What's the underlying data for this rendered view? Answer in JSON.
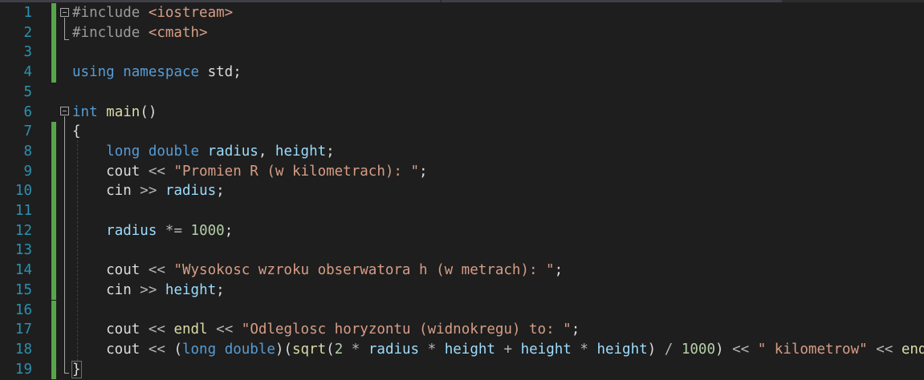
{
  "editor": {
    "line_numbers": [
      "1",
      "2",
      "3",
      "4",
      "5",
      "6",
      "7",
      "8",
      "9",
      "10",
      "11",
      "12",
      "13",
      "14",
      "15",
      "16",
      "17",
      "18",
      "19"
    ],
    "lines": [
      [
        {
          "t": "#include ",
          "c": "pp"
        },
        {
          "t": "<iostream>",
          "c": "inc"
        }
      ],
      [
        {
          "t": "#include ",
          "c": "pp"
        },
        {
          "t": "<cmath>",
          "c": "inc"
        }
      ],
      [],
      [
        {
          "t": "using",
          "c": "kw"
        },
        {
          "t": " ",
          "c": "id"
        },
        {
          "t": "namespace",
          "c": "kw"
        },
        {
          "t": " std;",
          "c": "id"
        }
      ],
      [],
      [
        {
          "t": "int",
          "c": "kw"
        },
        {
          "t": " ",
          "c": "id"
        },
        {
          "t": "main",
          "c": "fn"
        },
        {
          "t": "()",
          "c": "id"
        }
      ],
      [
        {
          "t": "{",
          "c": "id"
        }
      ],
      [
        {
          "t": "    ",
          "c": "id"
        },
        {
          "t": "long",
          "c": "kw"
        },
        {
          "t": " ",
          "c": "id"
        },
        {
          "t": "double",
          "c": "kw"
        },
        {
          "t": " ",
          "c": "id"
        },
        {
          "t": "radius",
          "c": "var"
        },
        {
          "t": ", ",
          "c": "id"
        },
        {
          "t": "height",
          "c": "var"
        },
        {
          "t": ";",
          "c": "id"
        }
      ],
      [
        {
          "t": "    cout ",
          "c": "id"
        },
        {
          "t": "<<",
          "c": "op"
        },
        {
          "t": " ",
          "c": "id"
        },
        {
          "t": "\"Promien R (w kilometrach): \"",
          "c": "str"
        },
        {
          "t": ";",
          "c": "id"
        }
      ],
      [
        {
          "t": "    cin ",
          "c": "id"
        },
        {
          "t": ">>",
          "c": "op"
        },
        {
          "t": " ",
          "c": "id"
        },
        {
          "t": "radius",
          "c": "var"
        },
        {
          "t": ";",
          "c": "id"
        }
      ],
      [],
      [
        {
          "t": "    ",
          "c": "id"
        },
        {
          "t": "radius",
          "c": "var"
        },
        {
          "t": " ",
          "c": "id"
        },
        {
          "t": "*=",
          "c": "op"
        },
        {
          "t": " ",
          "c": "id"
        },
        {
          "t": "1000",
          "c": "num"
        },
        {
          "t": ";",
          "c": "id"
        }
      ],
      [],
      [
        {
          "t": "    cout ",
          "c": "id"
        },
        {
          "t": "<<",
          "c": "op"
        },
        {
          "t": " ",
          "c": "id"
        },
        {
          "t": "\"Wysokosc wzroku obserwatora h (w metrach): \"",
          "c": "str"
        },
        {
          "t": ";",
          "c": "id"
        }
      ],
      [
        {
          "t": "    cin ",
          "c": "id"
        },
        {
          "t": ">>",
          "c": "op"
        },
        {
          "t": " ",
          "c": "id"
        },
        {
          "t": "height",
          "c": "var"
        },
        {
          "t": ";",
          "c": "id"
        }
      ],
      [],
      [
        {
          "t": "    cout ",
          "c": "id"
        },
        {
          "t": "<<",
          "c": "op"
        },
        {
          "t": " ",
          "c": "id"
        },
        {
          "t": "endl",
          "c": "endl"
        },
        {
          "t": " ",
          "c": "id"
        },
        {
          "t": "<<",
          "c": "op"
        },
        {
          "t": " ",
          "c": "id"
        },
        {
          "t": "\"Odleglosc horyzontu (widnokregu) to: \"",
          "c": "str"
        },
        {
          "t": ";",
          "c": "id"
        }
      ],
      [
        {
          "t": "    cout ",
          "c": "id"
        },
        {
          "t": "<<",
          "c": "op"
        },
        {
          "t": " (",
          "c": "id"
        },
        {
          "t": "long",
          "c": "kw"
        },
        {
          "t": " ",
          "c": "id"
        },
        {
          "t": "double",
          "c": "kw"
        },
        {
          "t": ")(",
          "c": "id"
        },
        {
          "t": "sqrt",
          "c": "fn"
        },
        {
          "t": "(",
          "c": "id"
        },
        {
          "t": "2",
          "c": "num"
        },
        {
          "t": " ",
          "c": "id"
        },
        {
          "t": "*",
          "c": "op"
        },
        {
          "t": " ",
          "c": "id"
        },
        {
          "t": "radius",
          "c": "var"
        },
        {
          "t": " ",
          "c": "id"
        },
        {
          "t": "*",
          "c": "op"
        },
        {
          "t": " ",
          "c": "id"
        },
        {
          "t": "height",
          "c": "var"
        },
        {
          "t": " ",
          "c": "id"
        },
        {
          "t": "+",
          "c": "op"
        },
        {
          "t": " ",
          "c": "id"
        },
        {
          "t": "height",
          "c": "var"
        },
        {
          "t": " ",
          "c": "id"
        },
        {
          "t": "*",
          "c": "op"
        },
        {
          "t": " ",
          "c": "id"
        },
        {
          "t": "height",
          "c": "var"
        },
        {
          "t": ") ",
          "c": "id"
        },
        {
          "t": "/",
          "c": "op"
        },
        {
          "t": " ",
          "c": "id"
        },
        {
          "t": "1000",
          "c": "num"
        },
        {
          "t": ") ",
          "c": "id"
        },
        {
          "t": "<<",
          "c": "op"
        },
        {
          "t": " ",
          "c": "id"
        },
        {
          "t": "\" kilometrow\"",
          "c": "str"
        },
        {
          "t": " ",
          "c": "id"
        },
        {
          "t": "<<",
          "c": "op"
        },
        {
          "t": " ",
          "c": "id"
        },
        {
          "t": "endl;",
          "c": "endl"
        }
      ],
      [
        {
          "t": "}",
          "c": "id"
        }
      ]
    ]
  },
  "colors": {
    "background": "#1e1e1e",
    "line_number": "#2b91af",
    "keyword": "#569cd6",
    "string": "#d69d85",
    "number": "#b5cea8",
    "variable": "#9cdcfe",
    "function": "#dcdcaa",
    "change_marker": "#57a64a"
  },
  "icons": {
    "fold_collapse": "minus-box-icon"
  }
}
